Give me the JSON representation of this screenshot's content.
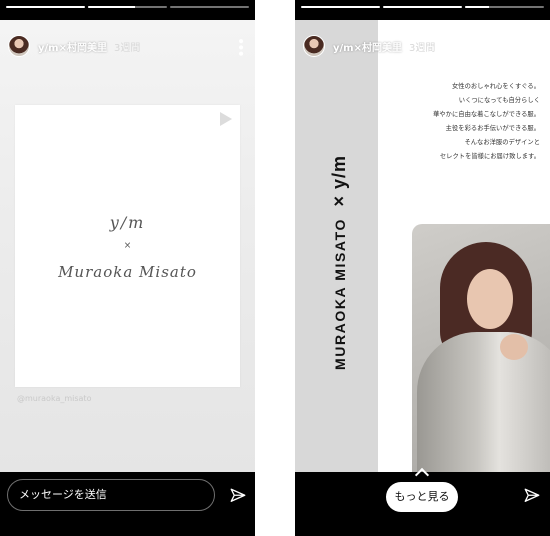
{
  "left_story": {
    "username": "y/m×村岡美里",
    "time": "3週間",
    "progress": [
      1,
      0.6,
      0
    ],
    "card": {
      "logo_line1": "y/m",
      "logo_line2": "×",
      "logo_line3": "Muraoka Misato"
    },
    "mention_tag": "@muraoka_misato",
    "message_placeholder": "メッセージを送信"
  },
  "right_story": {
    "username": "y/m×村岡美里",
    "time": "3週間",
    "progress": [
      1,
      1,
      0.3
    ],
    "vertical_title": "MURAOKA MISATO",
    "vertical_brand": "× y/m",
    "copy_lines": [
      "女性のおしゃれ心をくすぐる。",
      "いくつになっても自分らしく",
      "華やかに自由な着こなしができる服。",
      "主役を彩るお手伝いができる服。",
      "そんなお洋服のデザインと",
      "セレクトを皆様にお届け致します。"
    ],
    "more_button": "もっと見る"
  },
  "colors": {
    "background": "#000000",
    "strip": "#d8d8d8",
    "card": "#ffffff"
  },
  "icons": [
    "more-options-icon",
    "send-icon",
    "play-icon",
    "chevron-up-icon"
  ]
}
